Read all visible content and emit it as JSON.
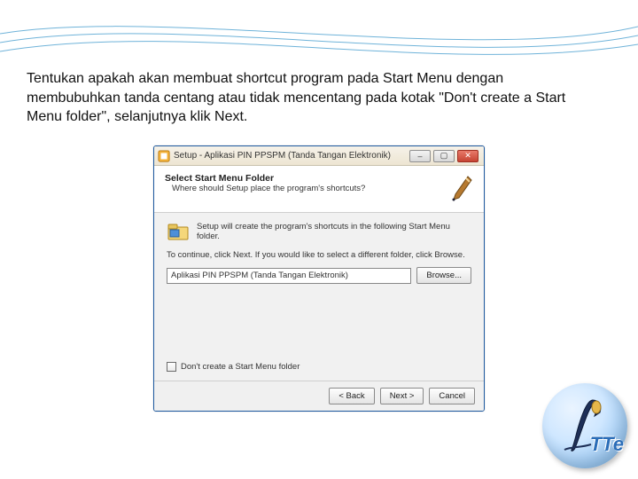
{
  "slide": {
    "text": "Tentukan apakah akan membuat shortcut program pada Start Menu dengan membubuhkan tanda centang atau tidak mencentang pada kotak \"Don't create a Start Menu folder\", selanjutnya klik Next."
  },
  "titlebar": {
    "title": "Setup - Aplikasi PIN PPSPM (Tanda Tangan Elektronik)",
    "min": "–",
    "max": "▢",
    "close": "✕"
  },
  "banner": {
    "heading": "Select Start Menu Folder",
    "sub": "Where should Setup place the program's shortcuts?"
  },
  "body": {
    "desc": "Setup will create the program's shortcuts in the following Start Menu folder.",
    "cont": "To continue, click Next. If you would like to select a different folder, click Browse.",
    "path_value": "Aplikasi PIN PPSPM (Tanda Tangan Elektronik)",
    "browse": "Browse..."
  },
  "check": {
    "label": "Don't create a Start Menu folder"
  },
  "footer": {
    "back": "< Back",
    "next": "Next >",
    "cancel": "Cancel"
  },
  "logo": {
    "text": "TTe"
  }
}
